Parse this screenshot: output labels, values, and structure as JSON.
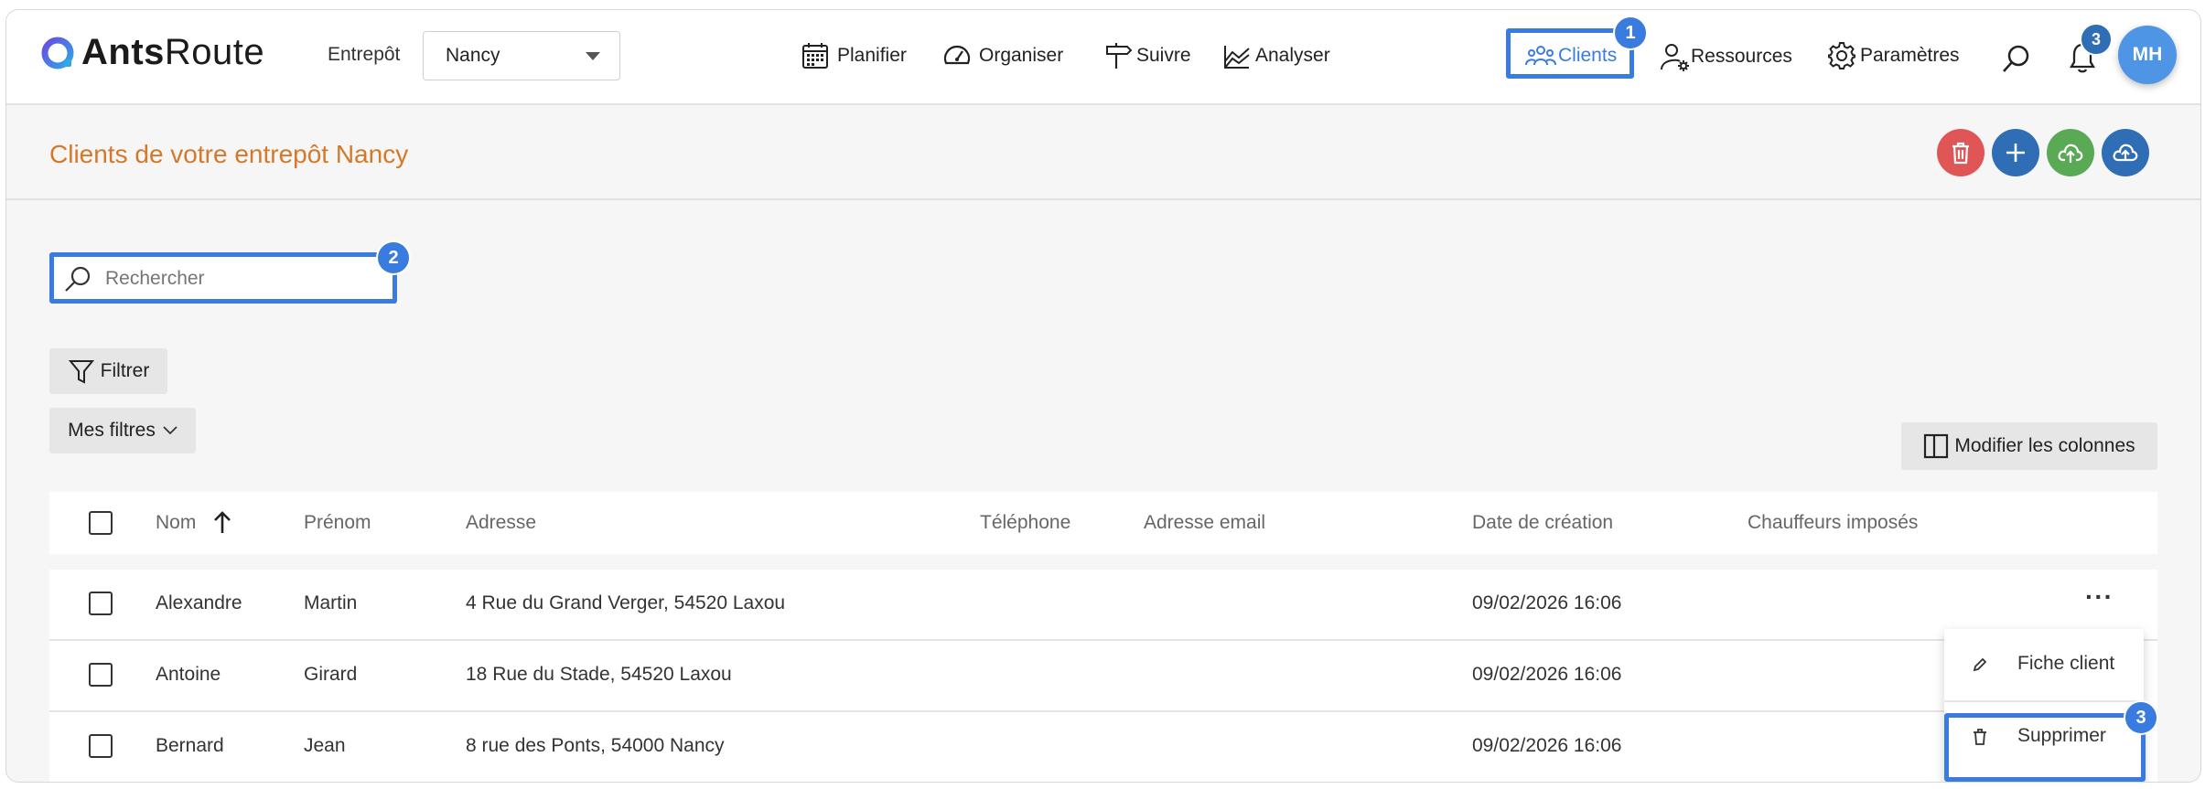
{
  "brand": {
    "name_bold": "Ants",
    "name_light": "Route"
  },
  "warehouse": {
    "label": "Entrepôt",
    "selected": "Nancy"
  },
  "nav": {
    "planifier": "Planifier",
    "organiser": "Organiser",
    "suivre": "Suivre",
    "analyser": "Analyser",
    "clients": "Clients",
    "ressources": "Ressources",
    "parametres": "Paramètres"
  },
  "notifications": {
    "count": "3"
  },
  "user": {
    "initials": "MH"
  },
  "page": {
    "title": "Clients de votre entrepôt Nancy"
  },
  "search": {
    "placeholder": "Rechercher"
  },
  "filters": {
    "filter_label": "Filtrer",
    "my_filters_label": "Mes filtres",
    "columns_label": "Modifier les colonnes"
  },
  "table": {
    "headers": {
      "nom": "Nom",
      "prenom": "Prénom",
      "adresse": "Adresse",
      "telephone": "Téléphone",
      "email": "Adresse email",
      "date": "Date de création",
      "chauffeurs": "Chauffeurs imposés"
    },
    "rows": [
      {
        "nom": "Alexandre",
        "prenom": "Martin",
        "adresse": "4 Rue du Grand Verger, 54520 Laxou",
        "telephone": "",
        "email": "",
        "date": "09/02/2026 16:06",
        "chauffeurs": ""
      },
      {
        "nom": "Antoine",
        "prenom": "Girard",
        "adresse": "18 Rue du Stade, 54520 Laxou",
        "telephone": "",
        "email": "",
        "date": "09/02/2026 16:06",
        "chauffeurs": ""
      },
      {
        "nom": "Bernard",
        "prenom": "Jean",
        "adresse": "8 rue des Ponts, 54000 Nancy",
        "telephone": "",
        "email": "",
        "date": "09/02/2026 16:06",
        "chauffeurs": ""
      }
    ]
  },
  "row_menu": {
    "more": "···",
    "edit": "Fiche client",
    "delete": "Supprimer"
  },
  "step_badges": {
    "one": "1",
    "two": "2",
    "three": "3"
  },
  "colors": {
    "accent": "#3a7be0",
    "title": "#d4792a",
    "delete": "#e05555",
    "add": "#2f6db5",
    "import": "#5aaa55",
    "export": "#2f6db5"
  }
}
